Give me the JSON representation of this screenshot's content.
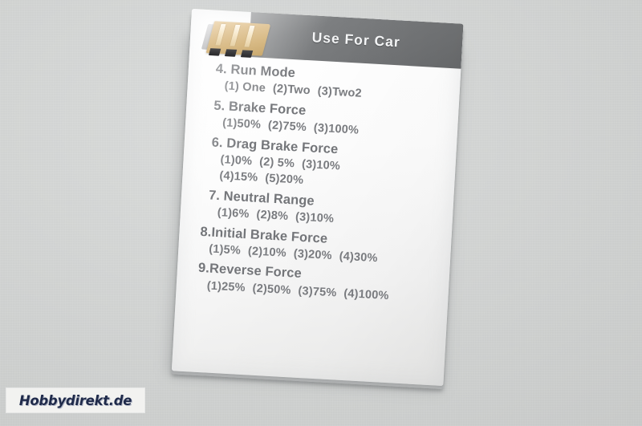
{
  "photo": {
    "background_color": "#d2d4d3",
    "subject": "esc-program-card"
  },
  "card": {
    "header": {
      "title": "Use For Car",
      "band_color": "#7a7c7e",
      "text_color": "#f4f5f6"
    },
    "body_color": "#fbfbfb",
    "text_color": "#76787c",
    "items": [
      {
        "number": "4.",
        "title": "4. Run Mode",
        "options": [
          "(1) One",
          "(2)Two",
          "(3)Two2"
        ],
        "option_lines": [
          [
            "(1) One",
            "(2)Two",
            "(3)Two2"
          ]
        ]
      },
      {
        "number": "5.",
        "title": "5. Brake Force",
        "options": [
          "(1)50%",
          "(2)75%",
          "(3)100%"
        ],
        "option_lines": [
          [
            "(1)50%",
            "(2)75%",
            "(3)100%"
          ]
        ]
      },
      {
        "number": "6.",
        "title": "6. Drag Brake Force",
        "options": [
          "(1)0%",
          "(2) 5%",
          "(3)10%",
          "(4)15%",
          "(5)20%"
        ],
        "option_lines": [
          [
            "(1)0%",
            "(2) 5%",
            "(3)10%"
          ],
          [
            "(4)15%",
            "(5)20%"
          ]
        ]
      },
      {
        "number": "7.",
        "title": "7. Neutral Range",
        "options": [
          "(1)6%",
          "(2)8%",
          "(3)10%"
        ],
        "option_lines": [
          [
            "(1)6%",
            "(2)8%",
            "(3)10%"
          ]
        ]
      },
      {
        "number": "8.",
        "title": "8.Initial Brake Force",
        "options": [
          "(1)5%",
          "(2)10%",
          "(3)20%",
          "(4)30%"
        ],
        "option_lines": [
          [
            "(1)5%",
            "(2)10%",
            "(3)20%",
            "(4)30%"
          ]
        ]
      },
      {
        "number": "9.",
        "title": "9.Reverse Force",
        "options": [
          "(1)25%",
          "(2)50%",
          "(3)75%",
          "(4)100%"
        ],
        "option_lines": [
          [
            "(1)25%",
            "(2)50%",
            "(3)75%",
            "(4)100%"
          ]
        ]
      }
    ]
  },
  "connector": {
    "label": "gold-contact-pins",
    "pin_count": 3,
    "color": "#ddc393"
  },
  "watermark": {
    "text": "Hobbydirekt.de",
    "text_color": "#1f2a4a",
    "background_color": "#f2f2f0"
  }
}
